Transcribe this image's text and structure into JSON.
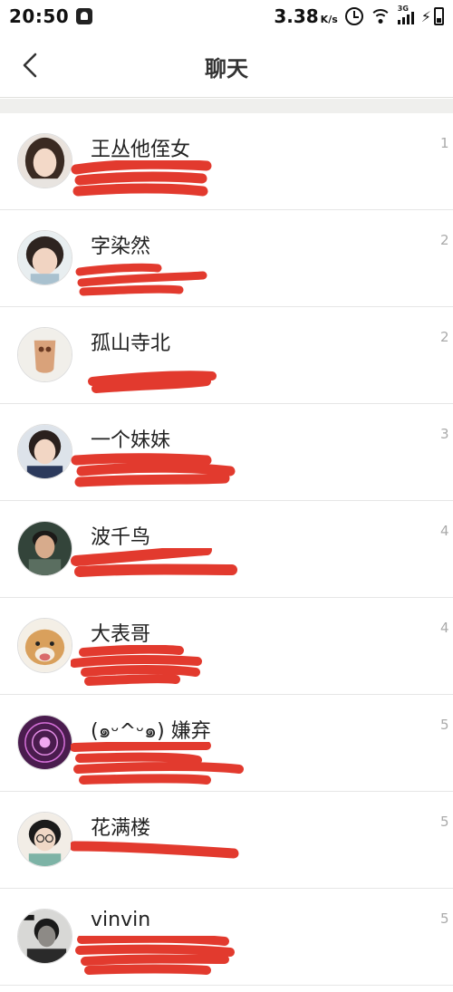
{
  "status_bar": {
    "time": "20:50",
    "network_speed": "3.38",
    "speed_unit": "K/s",
    "network_type": "3G"
  },
  "header": {
    "title": "聊天"
  },
  "colors": {
    "redaction": "#e23a2e",
    "divider": "#e6e6e6",
    "band": "#efefed"
  },
  "chats": [
    {
      "name": "王丛他侄女",
      "time": "1"
    },
    {
      "name": "字染然",
      "time": "2"
    },
    {
      "name": "孤山寺北",
      "time": "2"
    },
    {
      "name": "一个妹妹",
      "time": "3"
    },
    {
      "name": "波千鸟",
      "time": "4"
    },
    {
      "name": "大表哥",
      "time": "4"
    },
    {
      "name": "(๑ᵕ^ᵕ๑) 嫌弃",
      "time": "5"
    },
    {
      "name": "花满楼",
      "time": "5"
    },
    {
      "name": "vinvin",
      "time": "5"
    }
  ]
}
